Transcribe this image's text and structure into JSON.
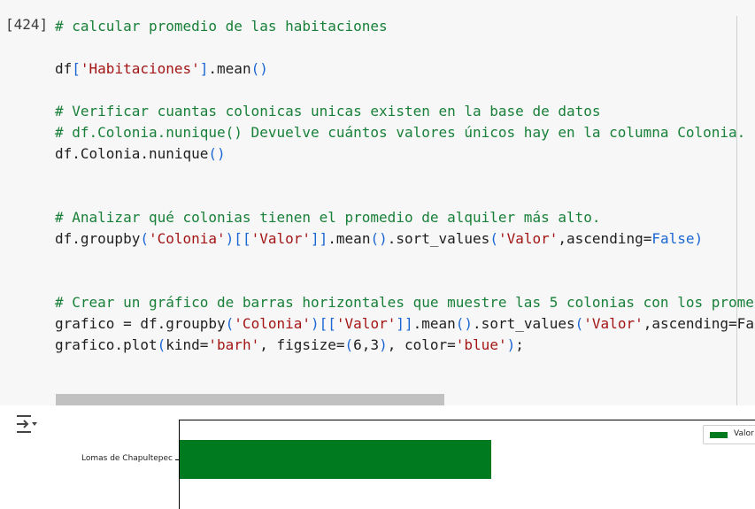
{
  "cell": {
    "execution_count": "[424]",
    "lines": [
      [
        {
          "t": "cm",
          "v": "# calcular promedio de las habitaciones"
        }
      ],
      [],
      [
        {
          "t": "tx",
          "v": "df"
        },
        {
          "t": "br",
          "v": "["
        },
        {
          "t": "st",
          "v": "'Habitaciones'"
        },
        {
          "t": "br",
          "v": "]"
        },
        {
          "t": "tx",
          "v": ".mean"
        },
        {
          "t": "br",
          "v": "()"
        }
      ],
      [],
      [
        {
          "t": "cm",
          "v": "# Verificar cuantas colonicas unicas existen en la base de datos"
        }
      ],
      [
        {
          "t": "cm",
          "v": "# df.Colonia.nunique() Devuelve cuántos valores únicos hay en la columna Colonia."
        }
      ],
      [
        {
          "t": "tx",
          "v": "df.Colonia.nunique"
        },
        {
          "t": "br",
          "v": "()"
        }
      ],
      [],
      [],
      [
        {
          "t": "cm",
          "v": "# Analizar qué colonias tienen el promedio de alquiler más alto."
        }
      ],
      [
        {
          "t": "tx",
          "v": "df.groupby"
        },
        {
          "t": "br",
          "v": "("
        },
        {
          "t": "st",
          "v": "'Colonia'"
        },
        {
          "t": "br",
          "v": ")[["
        },
        {
          "t": "st",
          "v": "'Valor'"
        },
        {
          "t": "br",
          "v": "]]"
        },
        {
          "t": "tx",
          "v": ".mean"
        },
        {
          "t": "br",
          "v": "()"
        },
        {
          "t": "tx",
          "v": ".sort_values"
        },
        {
          "t": "br",
          "v": "("
        },
        {
          "t": "st",
          "v": "'Valor'"
        },
        {
          "t": "tx",
          "v": ",ascending="
        },
        {
          "t": "kw",
          "v": "False"
        },
        {
          "t": "br",
          "v": ")"
        }
      ],
      [],
      [],
      [
        {
          "t": "cm",
          "v": "# Crear un gráfico de barras horizontales que muestre las 5 colonias con los prome"
        }
      ],
      [
        {
          "t": "tx",
          "v": "grafico = df.groupby"
        },
        {
          "t": "br",
          "v": "("
        },
        {
          "t": "st",
          "v": "'Colonia'"
        },
        {
          "t": "br",
          "v": ")[["
        },
        {
          "t": "st",
          "v": "'Valor'"
        },
        {
          "t": "br",
          "v": "]]"
        },
        {
          "t": "tx",
          "v": ".mean"
        },
        {
          "t": "br",
          "v": "()"
        },
        {
          "t": "tx",
          "v": ".sort_values"
        },
        {
          "t": "br",
          "v": "("
        },
        {
          "t": "st",
          "v": "'Valor'"
        },
        {
          "t": "tx",
          "v": ",ascending=Fa"
        }
      ],
      [
        {
          "t": "tx",
          "v": "grafico.plot"
        },
        {
          "t": "br",
          "v": "("
        },
        {
          "t": "tx",
          "v": "kind="
        },
        {
          "t": "st",
          "v": "'barh'"
        },
        {
          "t": "tx",
          "v": ", figsize="
        },
        {
          "t": "br",
          "v": "("
        },
        {
          "t": "tx",
          "v": "6,3"
        },
        {
          "t": "br",
          "v": ")"
        },
        {
          "t": "tx",
          "v": ", color="
        },
        {
          "t": "st",
          "v": "'blue'"
        },
        {
          "t": "br",
          "v": ")"
        },
        {
          "t": "tx",
          "v": ";"
        }
      ]
    ]
  },
  "output": {
    "icon": "output-toggle-icon"
  },
  "chart_data": {
    "type": "bar",
    "orientation": "horizontal",
    "categories": [
      "Lomas de Chapultepec"
    ],
    "series": [
      {
        "name": "Valor",
        "values": [
          1.0
        ]
      }
    ],
    "bar_color": "#007a1f",
    "legend": "top-right",
    "visible_fraction_of_bar": 0.54
  }
}
